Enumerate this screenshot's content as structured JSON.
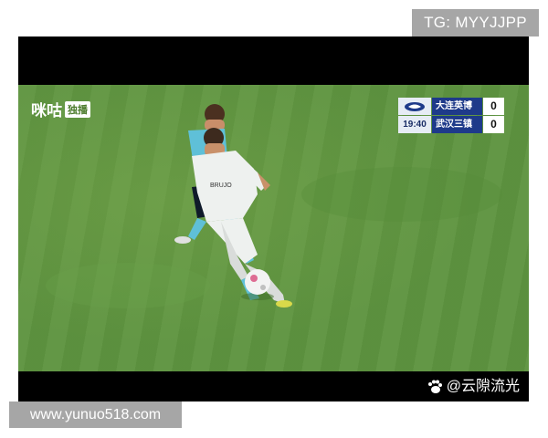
{
  "watermark_top": "TG: MYYJJPP",
  "watermark_bottom": "www.yunuo518.com",
  "broadcaster": {
    "logo_text": "咪咕",
    "tag": "独播"
  },
  "scoreboard": {
    "clock": "19:40",
    "home": {
      "team": "大连英博",
      "score": "0"
    },
    "away": {
      "team": "武汉三镇",
      "score": "0"
    }
  },
  "credit": "@云隙流光",
  "colors": {
    "pitch": "#5e9440",
    "scoreboard_team_bg": "#1e3a8a",
    "watermark_bg": "#a6a6a6"
  }
}
